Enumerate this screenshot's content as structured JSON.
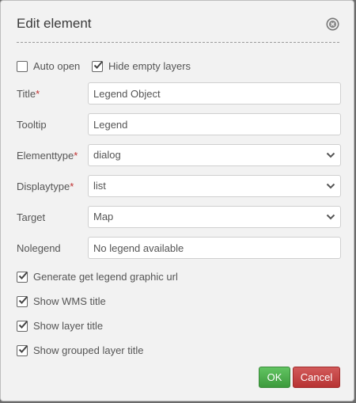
{
  "dialog": {
    "title": "Edit element",
    "close_icon": "close-circle-icon"
  },
  "top_options": [
    {
      "label": "Auto open",
      "checked": false
    },
    {
      "label": "Hide empty layers",
      "checked": true
    }
  ],
  "fields": {
    "title": {
      "label": "Title",
      "required": "*",
      "value": "Legend Object"
    },
    "tooltip": {
      "label": "Tooltip",
      "value": "Legend"
    },
    "elementtype": {
      "label": "Elementtype",
      "required": "*",
      "value": "dialog"
    },
    "displaytype": {
      "label": "Displaytype",
      "required": "*",
      "value": "list"
    },
    "target": {
      "label": "Target",
      "value": "Map"
    },
    "nolegend": {
      "label": "Nolegend",
      "value": "No legend available"
    }
  },
  "options": [
    {
      "label": "Generate get legend graphic url",
      "checked": true
    },
    {
      "label": "Show WMS title",
      "checked": true
    },
    {
      "label": "Show layer title",
      "checked": true
    },
    {
      "label": "Show grouped layer title",
      "checked": true
    }
  ],
  "buttons": {
    "ok": "OK",
    "cancel": "Cancel"
  },
  "colors": {
    "ok": "#5bb75b",
    "cancel": "#c9302c",
    "required": "#c03030"
  }
}
